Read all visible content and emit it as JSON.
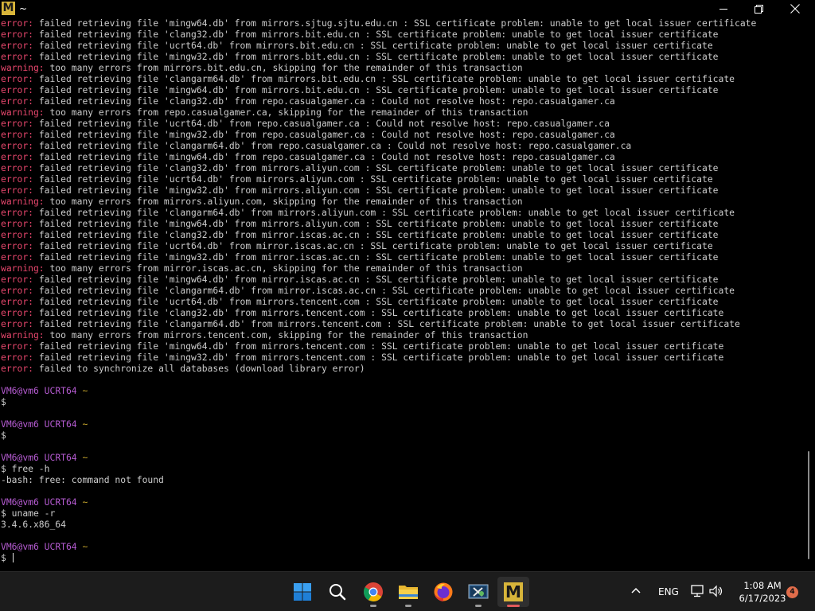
{
  "window": {
    "app_icon": "mintty-m-logo",
    "logo_letter": "M",
    "title": "~"
  },
  "terminal": {
    "lines": [
      [
        {
          "t": "error:",
          "k": "error"
        },
        {
          "t": " failed retrieving file 'mingw64.db' from mirrors.sjtug.sjtu.edu.cn : SSL certificate problem: unable to get local issuer certificate"
        }
      ],
      [
        {
          "t": "error:",
          "k": "error"
        },
        {
          "t": " failed retrieving file 'clang32.db' from mirrors.bit.edu.cn : SSL certificate problem: unable to get local issuer certificate"
        }
      ],
      [
        {
          "t": "error:",
          "k": "error"
        },
        {
          "t": " failed retrieving file 'ucrt64.db' from mirrors.bit.edu.cn : SSL certificate problem: unable to get local issuer certificate"
        }
      ],
      [
        {
          "t": "error:",
          "k": "error"
        },
        {
          "t": " failed retrieving file 'mingw32.db' from mirrors.bit.edu.cn : SSL certificate problem: unable to get local issuer certificate"
        }
      ],
      [
        {
          "t": "warning:",
          "k": "warning"
        },
        {
          "t": " too many errors from mirrors.bit.edu.cn, skipping for the remainder of this transaction"
        }
      ],
      [
        {
          "t": "error:",
          "k": "error"
        },
        {
          "t": " failed retrieving file 'clangarm64.db' from mirrors.bit.edu.cn : SSL certificate problem: unable to get local issuer certificate"
        }
      ],
      [
        {
          "t": "error:",
          "k": "error"
        },
        {
          "t": " failed retrieving file 'mingw64.db' from mirrors.bit.edu.cn : SSL certificate problem: unable to get local issuer certificate"
        }
      ],
      [
        {
          "t": "error:",
          "k": "error"
        },
        {
          "t": " failed retrieving file 'clang32.db' from repo.casualgamer.ca : Could not resolve host: repo.casualgamer.ca"
        }
      ],
      [
        {
          "t": "warning:",
          "k": "warning"
        },
        {
          "t": " too many errors from repo.casualgamer.ca, skipping for the remainder of this transaction"
        }
      ],
      [
        {
          "t": "error:",
          "k": "error"
        },
        {
          "t": " failed retrieving file 'ucrt64.db' from repo.casualgamer.ca : Could not resolve host: repo.casualgamer.ca"
        }
      ],
      [
        {
          "t": "error:",
          "k": "error"
        },
        {
          "t": " failed retrieving file 'mingw32.db' from repo.casualgamer.ca : Could not resolve host: repo.casualgamer.ca"
        }
      ],
      [
        {
          "t": "error:",
          "k": "error"
        },
        {
          "t": " failed retrieving file 'clangarm64.db' from repo.casualgamer.ca : Could not resolve host: repo.casualgamer.ca"
        }
      ],
      [
        {
          "t": "error:",
          "k": "error"
        },
        {
          "t": " failed retrieving file 'mingw64.db' from repo.casualgamer.ca : Could not resolve host: repo.casualgamer.ca"
        }
      ],
      [
        {
          "t": "error:",
          "k": "error"
        },
        {
          "t": " failed retrieving file 'clang32.db' from mirrors.aliyun.com : SSL certificate problem: unable to get local issuer certificate"
        }
      ],
      [
        {
          "t": "error:",
          "k": "error"
        },
        {
          "t": " failed retrieving file 'ucrt64.db' from mirrors.aliyun.com : SSL certificate problem: unable to get local issuer certificate"
        }
      ],
      [
        {
          "t": "error:",
          "k": "error"
        },
        {
          "t": " failed retrieving file 'mingw32.db' from mirrors.aliyun.com : SSL certificate problem: unable to get local issuer certificate"
        }
      ],
      [
        {
          "t": "warning:",
          "k": "warning"
        },
        {
          "t": " too many errors from mirrors.aliyun.com, skipping for the remainder of this transaction"
        }
      ],
      [
        {
          "t": "error:",
          "k": "error"
        },
        {
          "t": " failed retrieving file 'clangarm64.db' from mirrors.aliyun.com : SSL certificate problem: unable to get local issuer certificate"
        }
      ],
      [
        {
          "t": "error:",
          "k": "error"
        },
        {
          "t": " failed retrieving file 'mingw64.db' from mirrors.aliyun.com : SSL certificate problem: unable to get local issuer certificate"
        }
      ],
      [
        {
          "t": "error:",
          "k": "error"
        },
        {
          "t": " failed retrieving file 'clang32.db' from mirror.iscas.ac.cn : SSL certificate problem: unable to get local issuer certificate"
        }
      ],
      [
        {
          "t": "error:",
          "k": "error"
        },
        {
          "t": " failed retrieving file 'ucrt64.db' from mirror.iscas.ac.cn : SSL certificate problem: unable to get local issuer certificate"
        }
      ],
      [
        {
          "t": "error:",
          "k": "error"
        },
        {
          "t": " failed retrieving file 'mingw32.db' from mirror.iscas.ac.cn : SSL certificate problem: unable to get local issuer certificate"
        }
      ],
      [
        {
          "t": "warning:",
          "k": "warning"
        },
        {
          "t": " too many errors from mirror.iscas.ac.cn, skipping for the remainder of this transaction"
        }
      ],
      [
        {
          "t": "error:",
          "k": "error"
        },
        {
          "t": " failed retrieving file 'mingw64.db' from mirror.iscas.ac.cn : SSL certificate problem: unable to get local issuer certificate"
        }
      ],
      [
        {
          "t": "error:",
          "k": "error"
        },
        {
          "t": " failed retrieving file 'clangarm64.db' from mirror.iscas.ac.cn : SSL certificate problem: unable to get local issuer certificate"
        }
      ],
      [
        {
          "t": "error:",
          "k": "error"
        },
        {
          "t": " failed retrieving file 'ucrt64.db' from mirrors.tencent.com : SSL certificate problem: unable to get local issuer certificate"
        }
      ],
      [
        {
          "t": "error:",
          "k": "error"
        },
        {
          "t": " failed retrieving file 'clang32.db' from mirrors.tencent.com : SSL certificate problem: unable to get local issuer certificate"
        }
      ],
      [
        {
          "t": "error:",
          "k": "error"
        },
        {
          "t": " failed retrieving file 'clangarm64.db' from mirrors.tencent.com : SSL certificate problem: unable to get local issuer certificate"
        }
      ],
      [
        {
          "t": "warning:",
          "k": "warning"
        },
        {
          "t": " too many errors from mirrors.tencent.com, skipping for the remainder of this transaction"
        }
      ],
      [
        {
          "t": "error:",
          "k": "error"
        },
        {
          "t": " failed retrieving file 'mingw64.db' from mirrors.tencent.com : SSL certificate problem: unable to get local issuer certificate"
        }
      ],
      [
        {
          "t": "error:",
          "k": "error"
        },
        {
          "t": " failed retrieving file 'mingw32.db' from mirrors.tencent.com : SSL certificate problem: unable to get local issuer certificate"
        }
      ],
      [
        {
          "t": "error:",
          "k": "error"
        },
        {
          "t": " failed to synchronize all databases (download library error)"
        }
      ],
      [],
      [
        {
          "t": "VM6@vm6",
          "k": "user"
        },
        {
          "t": " "
        },
        {
          "t": "UCRT64",
          "k": "sys"
        },
        {
          "t": " "
        },
        {
          "t": "~",
          "k": "path"
        }
      ],
      [
        {
          "t": "$ "
        }
      ],
      [],
      [
        {
          "t": "VM6@vm6",
          "k": "user"
        },
        {
          "t": " "
        },
        {
          "t": "UCRT64",
          "k": "sys"
        },
        {
          "t": " "
        },
        {
          "t": "~",
          "k": "path"
        }
      ],
      [
        {
          "t": "$ "
        }
      ],
      [],
      [
        {
          "t": "VM6@vm6",
          "k": "user"
        },
        {
          "t": " "
        },
        {
          "t": "UCRT64",
          "k": "sys"
        },
        {
          "t": " "
        },
        {
          "t": "~",
          "k": "path"
        }
      ],
      [
        {
          "t": "$ free -h"
        }
      ],
      [
        {
          "t": "-bash: free: command not found"
        }
      ],
      [],
      [
        {
          "t": "VM6@vm6",
          "k": "user"
        },
        {
          "t": " "
        },
        {
          "t": "UCRT64",
          "k": "sys"
        },
        {
          "t": " "
        },
        {
          "t": "~",
          "k": "path"
        }
      ],
      [
        {
          "t": "$ uname -r"
        }
      ],
      [
        {
          "t": "3.4.6.x86_64"
        }
      ],
      [],
      [
        {
          "t": "VM6@vm6",
          "k": "user"
        },
        {
          "t": " "
        },
        {
          "t": "UCRT64",
          "k": "sys"
        },
        {
          "t": " "
        },
        {
          "t": "~",
          "k": "path"
        }
      ],
      [
        {
          "t": "$ "
        },
        {
          "cursor": true
        }
      ]
    ],
    "colors": {
      "error": "#e8476d",
      "prompt_user": "#b55bd1",
      "prompt_path": "#c9a82d",
      "text": "#cccccc",
      "background": "#000000"
    }
  },
  "taskbar": {
    "apps": [
      {
        "name": "start-icon",
        "indicator": false,
        "active": false
      },
      {
        "name": "search-icon",
        "indicator": false,
        "active": false
      },
      {
        "name": "chrome-icon",
        "indicator": true,
        "active": false
      },
      {
        "name": "file-explorer-icon",
        "indicator": true,
        "active": false
      },
      {
        "name": "firefox-icon",
        "indicator": false,
        "active": false
      },
      {
        "name": "snipping-tool-icon",
        "indicator": true,
        "active": false
      },
      {
        "name": "msys2-terminal-icon",
        "indicator": true,
        "active": true
      }
    ],
    "tray": {
      "chevron_icon": "chevron-up-icon",
      "language": "ENG",
      "network_icon": "network-icon",
      "volume_icon": "volume-icon",
      "time": "1:08 AM",
      "date": "6/17/2023",
      "notification_count": "4"
    }
  }
}
